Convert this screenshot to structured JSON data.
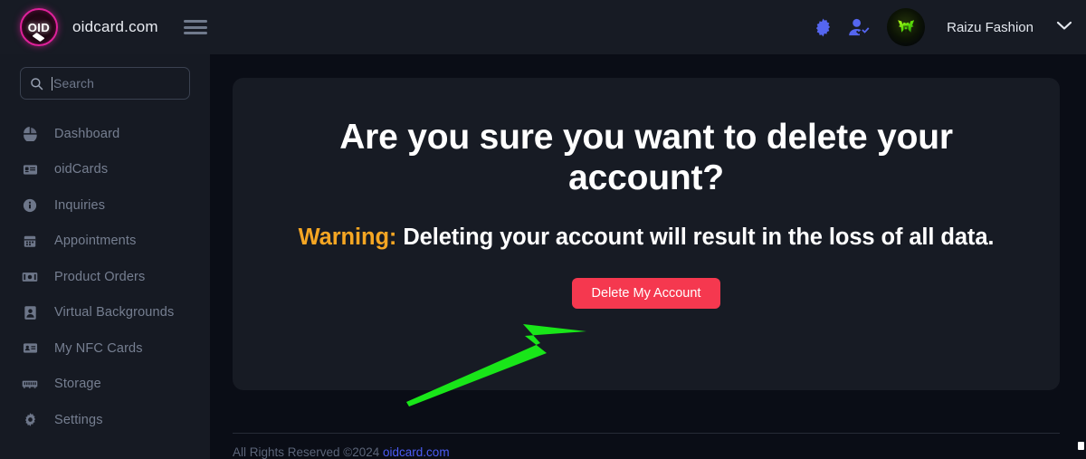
{
  "header": {
    "logo_text": "OID",
    "logo_icon": "oid-circle-logo",
    "brand_name": "oidcard.com",
    "menu_icon": "hamburger-menu-icon",
    "settings_icon": "gear-icon",
    "user_check_icon": "user-check-icon",
    "avatar_icon": "user-avatar",
    "username": "Raizu Fashion",
    "chevron_icon": "chevron-down-icon",
    "accent_pink": "#e0219b",
    "icon_blue": "#5566f0"
  },
  "sidebar": {
    "search": {
      "placeholder": "Search",
      "value": "",
      "icon": "search-icon"
    },
    "items": [
      {
        "label": "Dashboard",
        "icon": "pie-chart-icon"
      },
      {
        "label": "oidCards",
        "icon": "id-card-icon"
      },
      {
        "label": "Inquiries",
        "icon": "info-circle-icon"
      },
      {
        "label": "Appointments",
        "icon": "calendar-icon"
      },
      {
        "label": "Product Orders",
        "icon": "money-bill-icon"
      },
      {
        "label": "Virtual Backgrounds",
        "icon": "portrait-icon"
      },
      {
        "label": "My NFC Cards",
        "icon": "contact-card-icon"
      },
      {
        "label": "Storage",
        "icon": "memory-chip-icon"
      },
      {
        "label": "Settings",
        "icon": "gear-icon"
      }
    ]
  },
  "main": {
    "headline": "Are you sure you want to delete your account?",
    "warning_label": "Warning:",
    "warning_text": " Deleting your account will result in the loss of all data.",
    "warning_color": "#f5a623",
    "delete_button": "Delete My Account",
    "delete_button_color": "#f5384f"
  },
  "footer": {
    "text": "All Rights Reserved ©2024 ",
    "link": "oidcard.com",
    "link_color": "#4b5cf5"
  },
  "annotation": {
    "arrow_icon": "green-arrow-pointer",
    "arrow_color": "#19e619"
  }
}
